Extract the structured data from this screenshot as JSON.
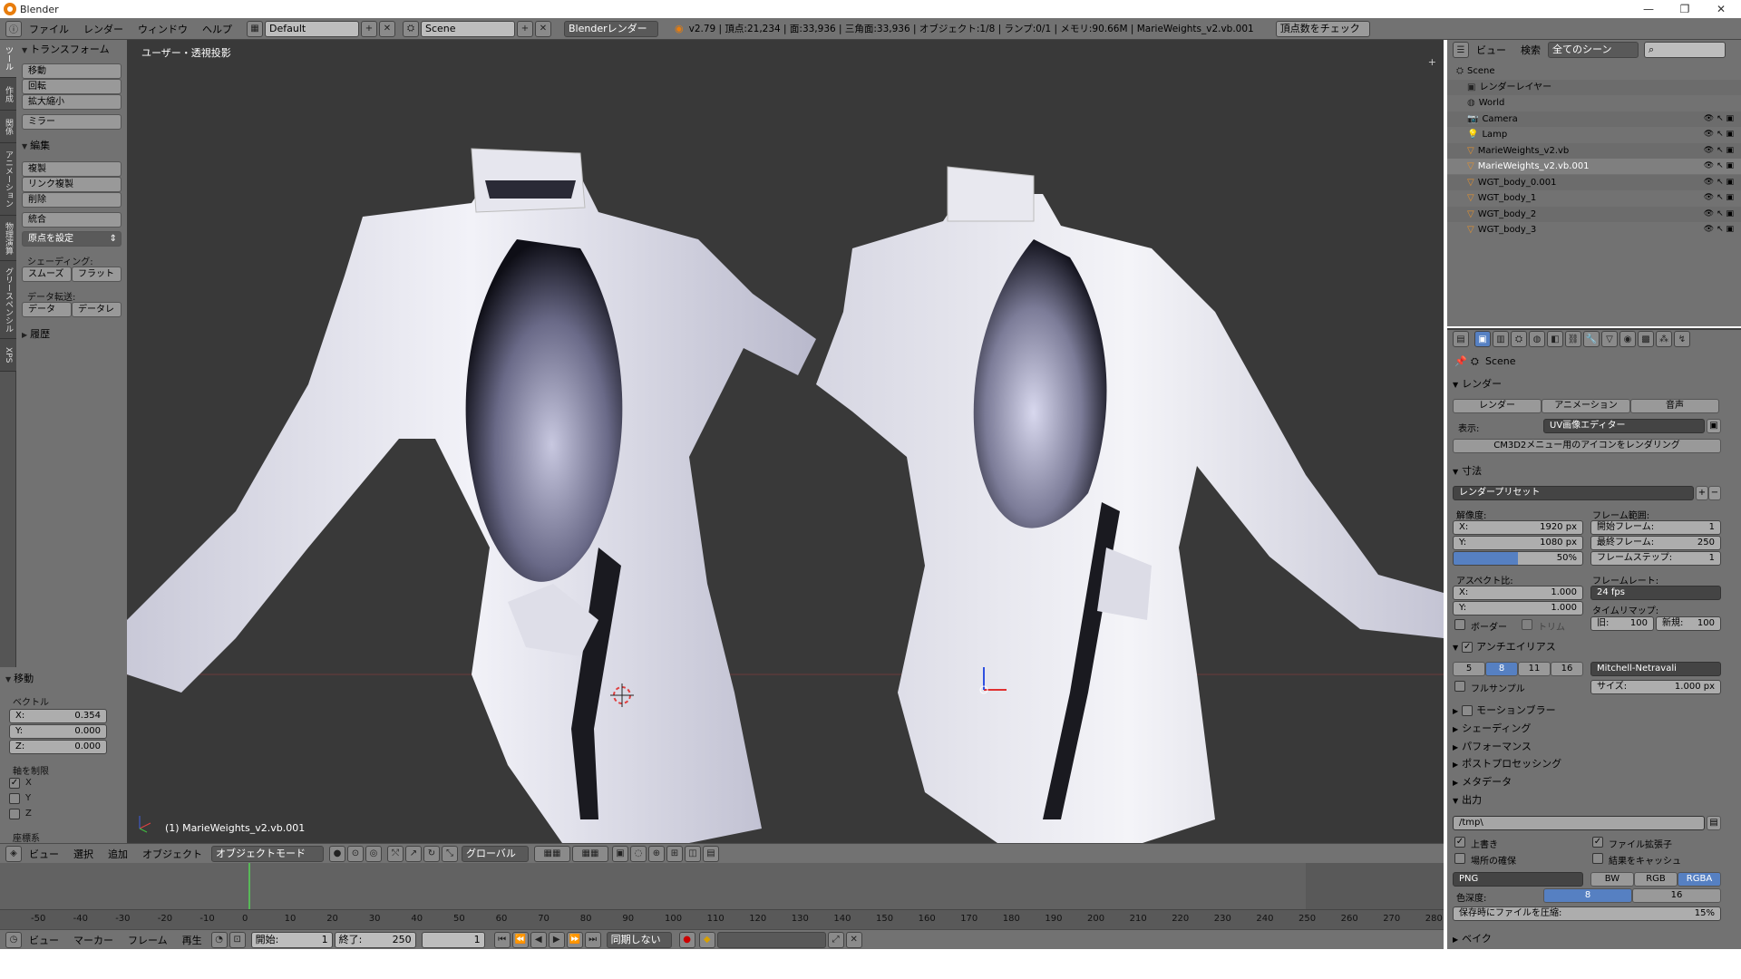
{
  "window": {
    "title": "Blender",
    "minimize": "—",
    "restore": "❐",
    "close": "✕"
  },
  "info_header": {
    "menus": [
      "ファイル",
      "レンダー",
      "ウィンドウ",
      "ヘルプ"
    ],
    "layout": "Default",
    "scene": "Scene",
    "engine": "Blenderレンダー",
    "stats": "v2.79 | 頂点:21,234 | 面:33,936 | 三角面:33,936 | オブジェクト:1/8 | ランプ:0/1 | メモリ:90.66M | MarieWeights_v2.vb.001",
    "check_button": "頂点数をチェック"
  },
  "tool_tabs": [
    "ツール",
    "作成",
    "関係",
    "アニメーション",
    "物理演算",
    "グリースペンシル",
    "XPS"
  ],
  "tool_shelf": {
    "transform": {
      "title": "トランスフォーム",
      "buttons": [
        "移動",
        "回転",
        "拡大縮小",
        "ミラー"
      ]
    },
    "edit": {
      "title": "編集",
      "buttons": [
        "複製",
        "リンク複製",
        "削除",
        "統合"
      ],
      "origin": "原点を設定"
    },
    "shading": {
      "label": "シェーディング:",
      "smooth": "スムーズ",
      "flat": "フラット"
    },
    "data_transfer": {
      "label": "データ転送:",
      "data": "データ",
      "data_layout": "データレ"
    },
    "history": "履歴",
    "operator": {
      "title": "移動",
      "vector_label": "ベクトル",
      "x_label": "X:",
      "x": "0.354",
      "y_label": "Y:",
      "y": "0.000",
      "z_label": "Z:",
      "z": "0.000",
      "constraint_label": "軸を制限",
      "cx": "X",
      "cy": "Y",
      "cz": "Z",
      "orientation_label": "座標系"
    }
  },
  "viewport": {
    "view_label": "ユーザー・透視投影",
    "object_label": "(1) MarieWeights_v2.vb.001"
  },
  "view3d_header": {
    "view": "ビュー",
    "select": "選択",
    "add": "追加",
    "object": "オブジェクト",
    "mode": "オブジェクトモード",
    "orientation": "グローバル"
  },
  "timeline": {
    "ticks": [
      "-50",
      "-40",
      "-30",
      "-20",
      "-10",
      "0",
      "10",
      "20",
      "30",
      "40",
      "50",
      "60",
      "70",
      "80",
      "90",
      "100",
      "110",
      "120",
      "130",
      "140",
      "150",
      "160",
      "170",
      "180",
      "190",
      "200",
      "210",
      "220",
      "230",
      "240",
      "250",
      "260",
      "270",
      "280"
    ],
    "menus": [
      "ビュー",
      "マーカー",
      "フレーム",
      "再生"
    ],
    "start_label": "開始:",
    "start": "1",
    "end_label": "終了:",
    "end": "250",
    "current": "1",
    "sync": "同期しない"
  },
  "outliner": {
    "header": {
      "view": "ビュー",
      "search": "検索",
      "filter": "全てのシーン"
    },
    "rows": [
      "Scene",
      "レンダーレイヤー",
      "World",
      "Camera",
      "Lamp",
      "MarieWeights_v2.vb",
      "MarieWeights_v2.vb.001",
      "WGT_body_0.001",
      "WGT_body_1",
      "WGT_body_2",
      "WGT_body_3"
    ]
  },
  "properties": {
    "context": "Scene",
    "render": {
      "title": "レンダー",
      "render_btn": "レンダー",
      "animation_btn": "アニメーション",
      "audio_btn": "音声",
      "display_label": "表示:",
      "display": "UV画像エディター",
      "cm3d2_btn": "CM3D2メニュー用のアイコンをレンダリング"
    },
    "dimensions": {
      "title": "寸法",
      "preset": "レンダープリセット",
      "resolution_label": "解像度:",
      "res_x_label": "X:",
      "res_x": "1920 px",
      "res_y_label": "Y:",
      "res_y": "1080 px",
      "res_pct": "50%",
      "frame_range_label": "フレーム範囲:",
      "start_label": "開始フレーム:",
      "start": "1",
      "end_label": "最終フレーム:",
      "end": "250",
      "step_label": "フレームステップ:",
      "step": "1",
      "aspect_label": "アスペクト比:",
      "asp_x_label": "X:",
      "asp_x": "1.000",
      "asp_y_label": "Y:",
      "asp_y": "1.000",
      "framerate_label": "フレームレート:",
      "framerate": "24 fps",
      "remap_label": "タイムリマップ:",
      "old_label": "旧:",
      "old": "100",
      "new_label": "新規:",
      "new": "100",
      "border": "ボーダー",
      "crop": "トリム"
    },
    "antialias": {
      "title": "アンチエイリアス",
      "samples": [
        "5",
        "8",
        "11",
        "16"
      ],
      "filter": "Mitchell-Netravali",
      "full_sample": "フルサンプル",
      "size_label": "サイズ:",
      "size": "1.000 px"
    },
    "collapsed": [
      "モーションブラー",
      "シェーディング",
      "パフォーマンス",
      "ポストプロセッシング",
      "メタデータ"
    ],
    "output": {
      "title": "出力",
      "path": "/tmp\\",
      "overwrite": "上書き",
      "extensions": "ファイル拡張子",
      "placeholders": "場所の確保",
      "cache": "結果をキャッシュ",
      "format": "PNG",
      "bw": "BW",
      "rgb": "RGB",
      "rgba": "RGBA",
      "depth_label": "色深度:",
      "depth8": "8",
      "depth16": "16",
      "compress_label": "保存時にファイルを圧縮:",
      "compress": "15%"
    },
    "bake": "ベイク"
  }
}
